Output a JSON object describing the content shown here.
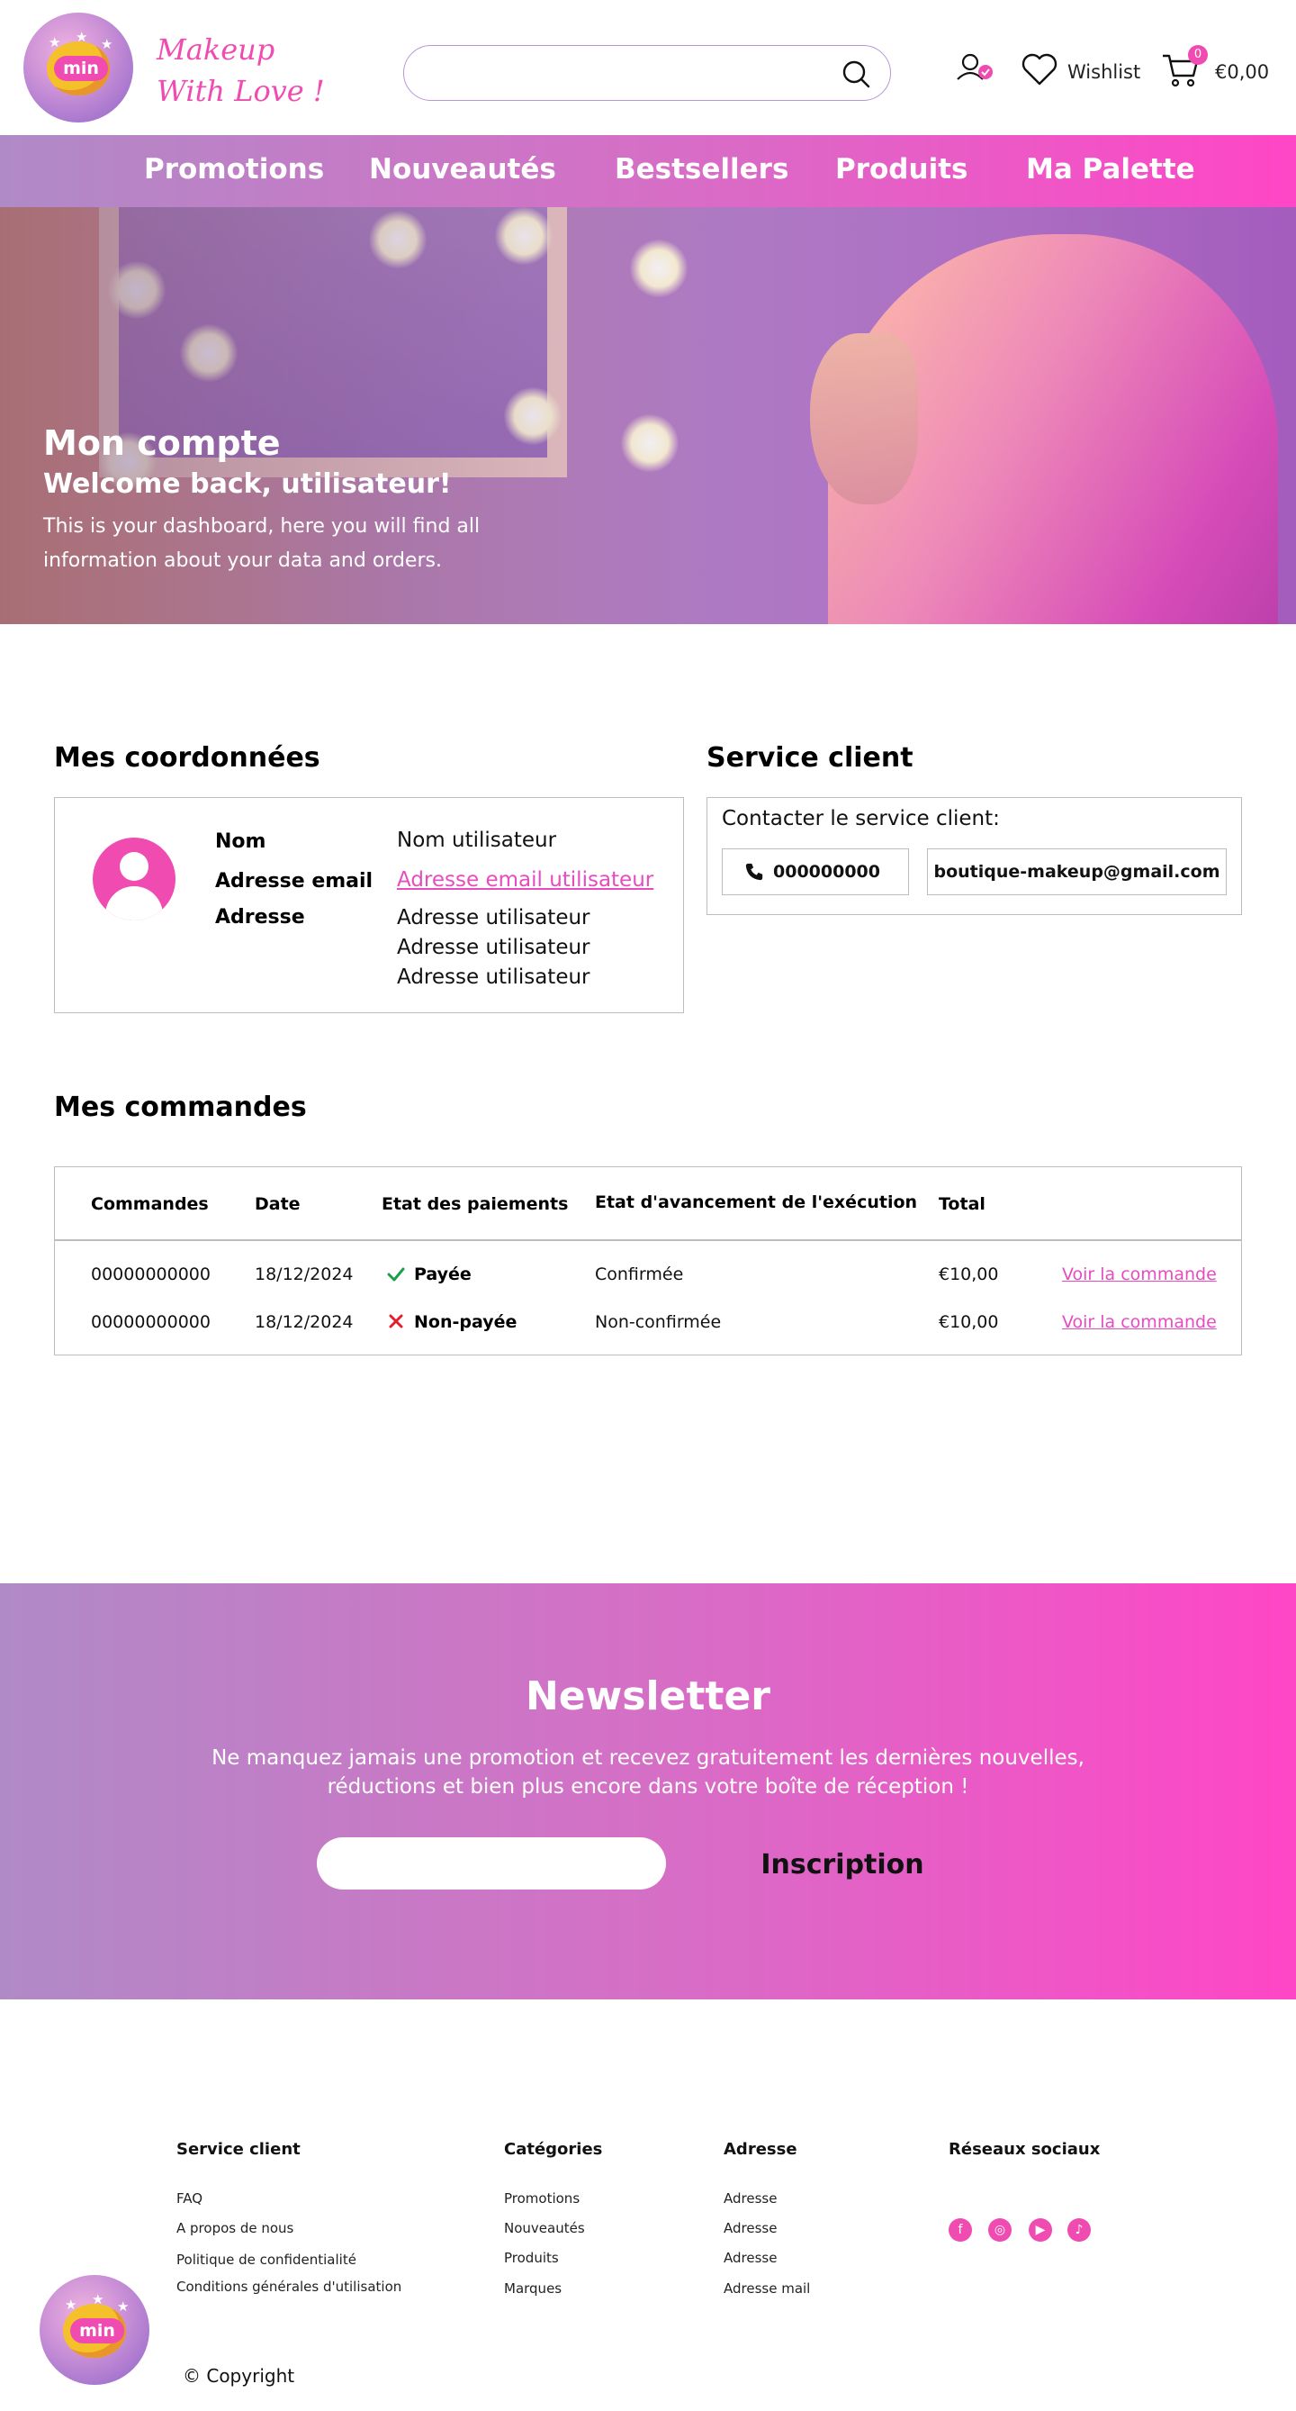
{
  "header": {
    "logo_text": "min",
    "tagline_line1": "Makeup",
    "tagline_line2": "With Love !",
    "search_placeholder": "",
    "wishlist_label": "Wishlist",
    "cart_count": "0",
    "cart_total": "€0,00"
  },
  "nav": {
    "items": [
      {
        "label": "Promotions"
      },
      {
        "label": "Nouveautés"
      },
      {
        "label": "Bestsellers"
      },
      {
        "label": "Produits"
      },
      {
        "label": "Ma Palette"
      }
    ]
  },
  "hero": {
    "title": "Mon compte",
    "subtitle": "Welcome back, utilisateur!",
    "text": "This is your dashboard, here you will find all information about your data and orders."
  },
  "account": {
    "title": "Mes coordonnées",
    "name_label": "Nom",
    "name_value": "Nom utilisateur",
    "email_label": "Adresse email",
    "email_value": "Adresse email utilisateur",
    "address_label": "Adresse",
    "address_lines": [
      "Adresse utilisateur",
      "Adresse utilisateur",
      "Adresse utilisateur"
    ]
  },
  "service": {
    "title": "Service client",
    "text": "Contacter le service client:",
    "phone": "000000000",
    "email": "boutique-makeup@gmail.com"
  },
  "orders": {
    "title": "Mes commandes",
    "columns": [
      "Commandes",
      "Date",
      "Etat des paiements",
      "Etat d'avancement de l'exécution",
      "Total"
    ],
    "rows": [
      {
        "id": "00000000000",
        "date": "18/12/2024",
        "payment": "Payée",
        "payment_status": "paid",
        "progress": "Confirmée",
        "total": "€10,00",
        "action": "Voir la commande"
      },
      {
        "id": "00000000000",
        "date": "18/12/2024",
        "payment": "Non-payée",
        "payment_status": "unpaid",
        "progress": "Non-confirmée",
        "total": "€10,00",
        "action": "Voir la commande"
      }
    ]
  },
  "newsletter": {
    "title": "Newsletter",
    "text_line1": "Ne manquez jamais une promotion et recevez gratuitement les dernières  nouvelles,",
    "text_line2": "réductions et bien plus encore dans votre boîte de  réception !",
    "input_placeholder": "",
    "button_label": "Inscription"
  },
  "footer": {
    "columns": [
      {
        "title": "Service client",
        "links": [
          "FAQ",
          "A propos de nous",
          "Politique de confidentialité",
          "Conditions générales d'utilisation"
        ]
      },
      {
        "title": "Catégories",
        "links": [
          "Promotions",
          "Nouveautés",
          "Produits",
          "Marques"
        ]
      },
      {
        "title": "Adresse",
        "links": [
          "Adresse",
          "Adresse",
          "Adresse",
          "Adresse mail"
        ]
      },
      {
        "title": "Réseaux sociaux",
        "links": []
      }
    ],
    "socials": [
      "facebook-icon",
      "instagram-icon",
      "youtube-icon",
      "tiktok-icon"
    ],
    "copyright": "© Copyright"
  },
  "colors": {
    "accent": "#f04bb0",
    "gradient_start": "#b08ac6",
    "gradient_end": "#ff46c6",
    "paid": "#1e9e4a",
    "unpaid": "#e0202c"
  }
}
